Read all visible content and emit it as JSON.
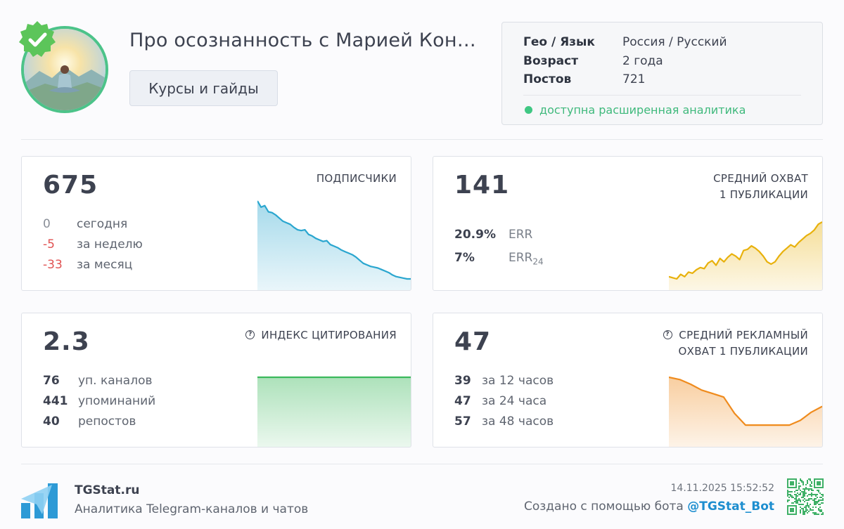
{
  "channel": {
    "title": "Про осознанность с Марией Конд...",
    "category": "Курсы и гайды"
  },
  "info": {
    "geo_label": "Гео / Язык",
    "geo_value": "Россия / Русский",
    "age_label": "Возраст",
    "age_value": "2 года",
    "posts_label": "Постов",
    "posts_value": "721",
    "analytics_text": "доступна расширенная аналитика"
  },
  "subscribers": {
    "value": "675",
    "label": "ПОДПИСЧИКИ",
    "today_value": "0",
    "today_label": "сегодня",
    "week_value": "-5",
    "week_label": "за неделю",
    "month_value": "-33",
    "month_label": "за месяц",
    "color": "#2aa6cf"
  },
  "reach": {
    "value": "141",
    "label_line1": "СРЕДНИЙ ОХВАТ",
    "label_line2": "1 ПУБЛИКАЦИИ",
    "err_value": "20.9%",
    "err_label": "ERR",
    "err24_value": "7%",
    "err24_label": "ERR",
    "err24_sub": "24",
    "color": "#e8b10c"
  },
  "citation": {
    "value": "2.3",
    "label": "ИНДЕКС ЦИТИРОВАНИЯ",
    "channels_value": "76",
    "channels_label": "уп. каналов",
    "mentions_value": "441",
    "mentions_label": "упоминаний",
    "reposts_value": "40",
    "reposts_label": "репостов",
    "color": "#3cb95c"
  },
  "ad_reach": {
    "value": "47",
    "label_line1": "СРЕДНИЙ РЕКЛАМНЫЙ",
    "label_line2": "ОХВАТ 1 ПУБЛИКАЦИИ",
    "h12_value": "39",
    "h12_label": "за 12 часов",
    "h24_value": "47",
    "h24_label": "за 24 часа",
    "h48_value": "57",
    "h48_label": "за 48 часов",
    "color": "#ef8b1d"
  },
  "footer": {
    "brand": "TGStat.ru",
    "tagline": "Аналитика Telegram-каналов и чатов",
    "timestamp": "14.11.2025 15:52:52",
    "created_prefix": "Создано с помощью бота ",
    "bot": "@TGStat_Bot"
  },
  "chart_data": [
    {
      "type": "area",
      "name": "subscribers-trend",
      "values": [
        100,
        92,
        94,
        86,
        85,
        82,
        78,
        74,
        72,
        70,
        66,
        63,
        62,
        63,
        57,
        55,
        52,
        50,
        48,
        49,
        44,
        42,
        40,
        37,
        35,
        33,
        31,
        28,
        24,
        20,
        18,
        16,
        15,
        14,
        12,
        10,
        8,
        5,
        3,
        2,
        1,
        0,
        0
      ],
      "ylim": [
        0,
        100
      ]
    },
    {
      "type": "area",
      "name": "reach-trend",
      "values": [
        4,
        2,
        0,
        8,
        4,
        12,
        10,
        16,
        20,
        18,
        28,
        32,
        24,
        36,
        30,
        38,
        44,
        40,
        34,
        50,
        52,
        58,
        54,
        48,
        40,
        30,
        26,
        30,
        40,
        48,
        54,
        60,
        56,
        64,
        70,
        76,
        80,
        86,
        96,
        100
      ],
      "ylim": [
        0,
        100
      ]
    },
    {
      "type": "area",
      "name": "citation-trend",
      "values": [
        100,
        100,
        100,
        100,
        100,
        100,
        100,
        100,
        100,
        100
      ],
      "ylim": [
        0,
        100
      ]
    },
    {
      "type": "area",
      "name": "ad-reach-trend",
      "values": [
        100,
        96,
        88,
        78,
        72,
        66,
        38,
        18,
        18,
        18,
        18,
        18,
        26,
        40,
        50
      ],
      "ylim": [
        0,
        100
      ]
    }
  ]
}
